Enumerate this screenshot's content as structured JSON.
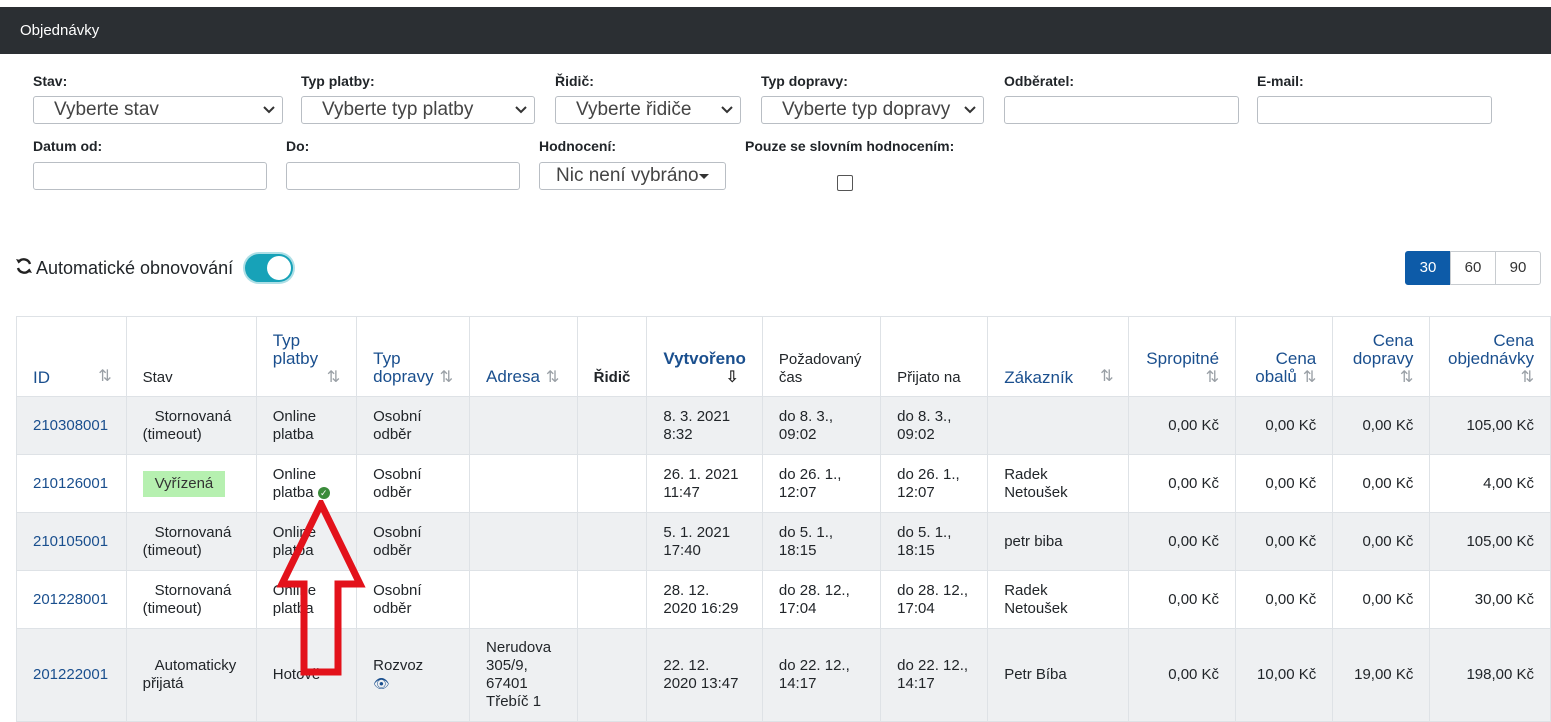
{
  "header": {
    "title": "Objednávky"
  },
  "filters": {
    "stav": {
      "label": "Stav:",
      "value": "Vyberte stav"
    },
    "typ_platby": {
      "label": "Typ platby:",
      "value": "Vyberte typ platby"
    },
    "ridic": {
      "label": "Řidič:",
      "value": "Vyberte řidiče"
    },
    "typ_dopravy": {
      "label": "Typ dopravy:",
      "value": "Vyberte typ dopravy"
    },
    "odberatel": {
      "label": "Odběratel:",
      "value": ""
    },
    "email": {
      "label": "E-mail:",
      "value": ""
    },
    "datum_od": {
      "label": "Datum od:",
      "value": ""
    },
    "do": {
      "label": "Do:",
      "value": ""
    },
    "hodnoceni": {
      "label": "Hodnocení:",
      "value": "Nic není vybráno"
    },
    "slovni": {
      "label": "Pouze se slovním hodnocením:",
      "checked": false
    }
  },
  "auto_refresh": {
    "label": "Automatické obnovování",
    "enabled": true
  },
  "page_sizes": [
    "30",
    "60",
    "90"
  ],
  "active_page_size": "30",
  "table": {
    "columns": [
      {
        "label": "ID",
        "sortable": true
      },
      {
        "label": "Stav",
        "sortable": false
      },
      {
        "label": "Typ platby",
        "sortable": true
      },
      {
        "label": "Typ dopravy",
        "sortable": true
      },
      {
        "label": "Adresa",
        "sortable": true
      },
      {
        "label": "Řidič",
        "sortable": false
      },
      {
        "label": "Vytvořeno",
        "sortable": true,
        "active": true
      },
      {
        "label": "Požadovaný čas",
        "sortable": false
      },
      {
        "label": "Přijato na",
        "sortable": false
      },
      {
        "label": "Zákazník",
        "sortable": true
      },
      {
        "label": "Spropitné",
        "sortable": true
      },
      {
        "label": "Cena obalů",
        "sortable": true
      },
      {
        "label": "Cena dopravy",
        "sortable": true
      },
      {
        "label": "Cena objednávky",
        "sortable": true
      }
    ],
    "rows": [
      {
        "id": "210308001",
        "stav": "Stornovaná (timeout)",
        "platba": "Online platba",
        "doprava": "Osobní odběr",
        "adresa": "",
        "ridic": "",
        "vytvoreno": "8. 3. 2021 8:32",
        "pozadovany": "do 8. 3., 09:02",
        "prijato": "do 8. 3., 09:02",
        "zakaznik": "",
        "spropitne": "0,00 Kč",
        "obaly": "0,00 Kč",
        "cena_dopravy": "0,00 Kč",
        "cena": "105,00 Kč"
      },
      {
        "id": "210126001",
        "stav": "Vyřízená",
        "platba": "Online platba",
        "doprava": "Osobní odběr",
        "adresa": "",
        "ridic": "",
        "vytvoreno": "26. 1. 2021 11:47",
        "pozadovany": "do 26. 1., 12:07",
        "prijato": "do 26. 1., 12:07",
        "zakaznik": "Radek Netoušek",
        "spropitne": "0,00 Kč",
        "obaly": "0,00 Kč",
        "cena_dopravy": "0,00 Kč",
        "cena": "4,00 Kč"
      },
      {
        "id": "210105001",
        "stav": "Stornovaná (timeout)",
        "platba": "Online platba",
        "doprava": "Osobní odběr",
        "adresa": "",
        "ridic": "",
        "vytvoreno": "5. 1. 2021 17:40",
        "pozadovany": "do 5. 1., 18:15",
        "prijato": "do 5. 1., 18:15",
        "zakaznik": "petr biba",
        "spropitne": "0,00 Kč",
        "obaly": "0,00 Kč",
        "cena_dopravy": "0,00 Kč",
        "cena": "105,00 Kč"
      },
      {
        "id": "201228001",
        "stav": "Stornovaná (timeout)",
        "platba": "Online platba",
        "doprava": "Osobní odběr",
        "adresa": "",
        "ridic": "",
        "vytvoreno": "28. 12. 2020 16:29",
        "pozadovany": "do 28. 12., 17:04",
        "prijato": "do 28. 12., 17:04",
        "zakaznik": "Radek Netoušek",
        "spropitne": "0,00 Kč",
        "obaly": "0,00 Kč",
        "cena_dopravy": "0,00 Kč",
        "cena": "30,00 Kč"
      },
      {
        "id": "201222001",
        "stav": "Automaticky přijatá",
        "platba": "Hotově",
        "doprava": "Rozvoz",
        "adresa": "Nerudova 305/9, 67401 Třebíč 1",
        "ridic": "",
        "vytvoreno": "22. 12. 2020 13:47",
        "pozadovany": "do 22. 12., 14:17",
        "prijato": "do 22. 12., 14:17",
        "zakaznik": "Petr Bíba",
        "spropitne": "0,00 Kč",
        "obaly": "10,00 Kč",
        "cena_dopravy": "19,00 Kč",
        "cena": "198,00 Kč"
      }
    ]
  },
  "colors": {
    "header_bg": "#2b2f33",
    "accent": "#0d5ba8",
    "toggle": "#17a2b8",
    "status_done": "#b6f0b0",
    "annotation_arrow": "#e3121b"
  }
}
